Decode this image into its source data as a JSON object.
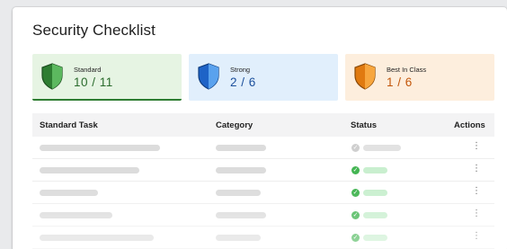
{
  "panel": {
    "title": "Security Checklist"
  },
  "tiers": [
    {
      "name": "Standard",
      "count": "10 / 11",
      "color": "#4caf50",
      "icon": "green-shield-icon"
    },
    {
      "name": "Strong",
      "count": "2 / 6",
      "color": "#2f7de1",
      "icon": "blue-shield-icon"
    },
    {
      "name": "Best In Class",
      "count": "1 / 6",
      "color": "#f39220",
      "icon": "orange-shield-icon"
    }
  ],
  "table": {
    "headers": {
      "task": "Standard Task",
      "category": "Category",
      "status": "Status",
      "actions": "Actions"
    },
    "rows": [
      {
        "status": "pending",
        "status_color": "#cfcfcf"
      },
      {
        "status": "complete",
        "status_color": "#43b552"
      },
      {
        "status": "complete",
        "status_color": "#43b552"
      },
      {
        "status": "complete",
        "status_color": "#43b552"
      },
      {
        "status": "complete",
        "status_color": "#43b552"
      }
    ],
    "actions_icon": "kebab-menu-icon"
  }
}
